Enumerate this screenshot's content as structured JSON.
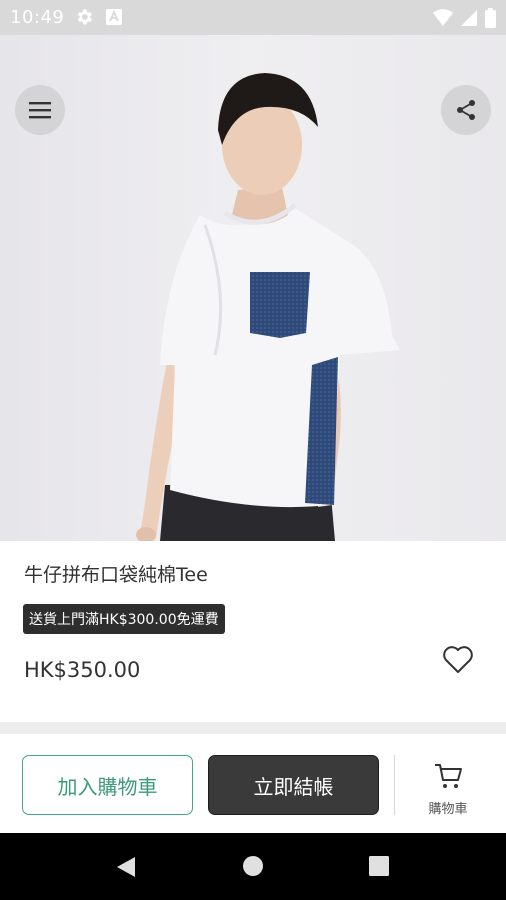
{
  "status_bar": {
    "time": "10:49",
    "icons": [
      "settings-gear-icon",
      "keyboard-a-icon",
      "wifi-icon",
      "cellular-signal-icon",
      "battery-icon"
    ]
  },
  "hero": {
    "image": "product-photo-model-white-tee-denim-pocket",
    "menu_icon": "hamburger-menu-icon",
    "share_icon": "share-icon"
  },
  "product": {
    "title": "牛仔拼布口袋純棉Tee",
    "promo": "送貨上門滿HK$300.00免運費",
    "price": "HK$350.00",
    "favorite_icon": "heart-outline-icon"
  },
  "actions": {
    "add_to_cart": "加入購物車",
    "checkout": "立即結帳",
    "cart_label": "購物車",
    "cart_icon": "shopping-cart-icon"
  },
  "colors": {
    "accent": "#43a680",
    "dark_button": "#3a3a3a",
    "status_bar": "#d9d9d9"
  },
  "nav": {
    "icons": [
      "back-icon",
      "home-icon",
      "recents-icon"
    ]
  }
}
